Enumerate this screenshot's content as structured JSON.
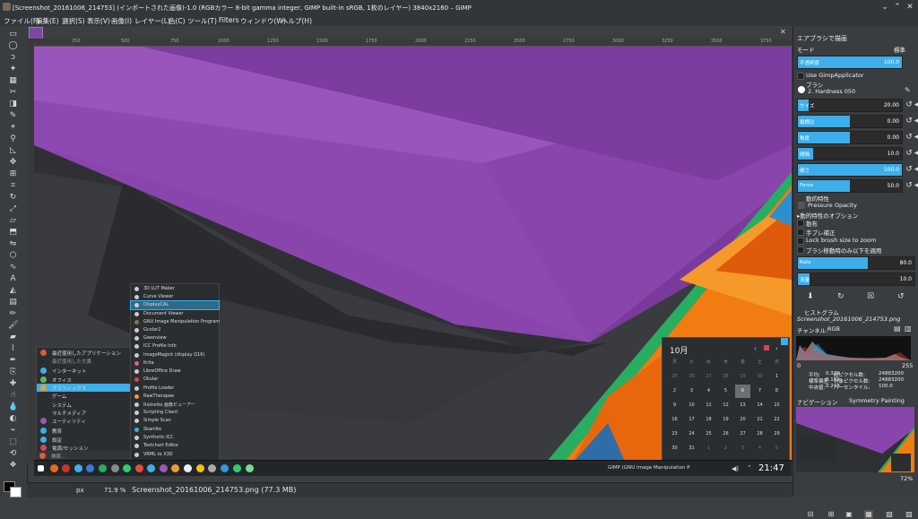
{
  "window": {
    "title": "[Screenshot_20161006_214753] (インポートされた画像)-1.0 (RGBカラー 8-bit gamma integer, GIMP built-in sRGB, 1枚のレイヤー) 3840x2160 – GIMP"
  },
  "menubar": [
    "ファイル(F)",
    "編集(E)",
    "選択(S)",
    "表示(V)",
    "画像(I)",
    "レイヤー(L)",
    "色(C)",
    "ツール(T)",
    "Filters",
    "ウィンドウ(W)",
    "ヘルプ(H)"
  ],
  "ruler": {
    "top_ticks": [
      "250",
      "500",
      "750",
      "1000",
      "1250",
      "1500",
      "1750",
      "2000",
      "2250",
      "2500",
      "2750",
      "3000",
      "3250",
      "3500",
      "3750"
    ]
  },
  "statusbar": {
    "unit": "px",
    "zoom": "71.9 %",
    "file": "Screenshot_20161006_214753.png (77.3 MB)"
  },
  "launcher": {
    "items": [
      {
        "label": "最近使用したアプリケーション",
        "color": "#e05a3a",
        "arrow": true
      },
      {
        "label": "最近使用した文書",
        "color": "#888888",
        "arrow": false
      },
      {
        "label": "インターネット",
        "color": "#3daee9",
        "arrow": true
      },
      {
        "label": "オフィス",
        "color": "#5fb85f",
        "arrow": true
      },
      {
        "label": "グラフィックス",
        "color": "#e8a030",
        "arrow": true
      },
      {
        "label": "ゲーム",
        "color": "#c0c0c0",
        "arrow": true
      },
      {
        "label": "システム",
        "color": "#c0c0c0",
        "arrow": true
      },
      {
        "label": "マルチメディア",
        "color": "#c0c0c0",
        "arrow": true
      },
      {
        "label": "ユーティリティ",
        "color": "#9b59b6",
        "arrow": true
      },
      {
        "label": "教育",
        "color": "#3daee9",
        "arrow": true
      },
      {
        "label": "設定",
        "color": "#3daee9",
        "arrow": true
      },
      {
        "label": "電源/セッション",
        "color": "#da4453",
        "arrow": true
      }
    ],
    "search_placeholder": "検索..."
  },
  "submenu": {
    "items": [
      "3D LUT Maker",
      "Curve Viewer",
      "DisplayCAL",
      "Document Viewer",
      "GNU Image Manipulation Program",
      "Gcolor2",
      "Gwenview",
      "ICC Profile Info",
      "ImageMagick (display Q16)",
      "Krita",
      "LibreOffice Draw",
      "Okular",
      "Profile Loader",
      "RawTherapee",
      "Ristretto 画像ビューアー",
      "Scripting Client",
      "Simple Scan",
      "Skanlite",
      "Synthetic ICC",
      "Testchart Editor",
      "VRML to X3D"
    ],
    "selected_index": 2
  },
  "taskbar": {
    "task_label": "GIMP (GNU Image Manipulation P",
    "clock": "21:47"
  },
  "calendar": {
    "month": "10月",
    "weekdays": [
      "月",
      "火",
      "水",
      "木",
      "金",
      "土",
      "日"
    ],
    "days": [
      [
        "25",
        "26",
        "27",
        "28",
        "29",
        "30",
        "1"
      ],
      [
        "2",
        "3",
        "4",
        "5",
        "6",
        "7",
        "8"
      ],
      [
        "9",
        "10",
        "11",
        "12",
        "13",
        "14",
        "15"
      ],
      [
        "16",
        "17",
        "18",
        "19",
        "20",
        "21",
        "22"
      ],
      [
        "23",
        "24",
        "25",
        "26",
        "27",
        "28",
        "29"
      ],
      [
        "30",
        "31",
        "1",
        "2",
        "3",
        "4",
        "5"
      ]
    ],
    "today": "6"
  },
  "dock": {
    "title": "エアブラシで描画",
    "mode_label": "モード",
    "mode_value": "標準",
    "opacity": {
      "label": "不透明度",
      "value": "100.0",
      "fill": 1.0
    },
    "use_applicator": "Use GimpApplicator",
    "brush_label": "ブラシ",
    "brush_value": "2. Hardness 050",
    "sliders": [
      {
        "label": "サイズ",
        "value": "20.00",
        "fill": 0.1
      },
      {
        "label": "縦横比",
        "value": "0.00",
        "fill": 0.5
      },
      {
        "label": "角度",
        "value": "0.00",
        "fill": 0.5
      },
      {
        "label": "間隔",
        "value": "10.0",
        "fill": 0.15
      },
      {
        "label": "硬さ",
        "value": "100.0",
        "fill": 1.0
      },
      {
        "label": "Force",
        "value": "50.0",
        "fill": 0.5
      }
    ],
    "dynamics_label": "動的特性",
    "dynamics_value": "Pressure Opacity",
    "dynamics_options": "▸動的特性のオプション",
    "checks": [
      "散布",
      "手ブレ補正",
      "Lock brush size to zoom",
      "ブラシ移動時のみ以下を適用"
    ],
    "rate": {
      "label": "Rate",
      "value": "80.0",
      "fill": 0.6
    },
    "flow": {
      "label": "流量",
      "value": "10.0",
      "fill": 0.1
    },
    "histogram": {
      "title": "ヒストグラム",
      "file": "Screenshot_20161006_214753.png",
      "channel_label": "チャンネル:",
      "channel_value": "RGB",
      "range_min": "0",
      "range_max": "255",
      "stats": [
        {
          "k": "平均:",
          "v": "0.329"
        },
        {
          "k": "標準偏差:",
          "v": "0.182"
        },
        {
          "k": "中央値:",
          "v": "0.243"
        },
        {
          "k": "総ピクセル数:",
          "v": "24883200"
        },
        {
          "k": "対象ピクセル数:",
          "v": "24883200"
        },
        {
          "k": "パーセンタイル:",
          "v": "100.0"
        }
      ]
    },
    "nav_tab": "ナビゲーション",
    "symmetry_tab": "Symmetry Painting",
    "nav_zoom": "72%"
  }
}
